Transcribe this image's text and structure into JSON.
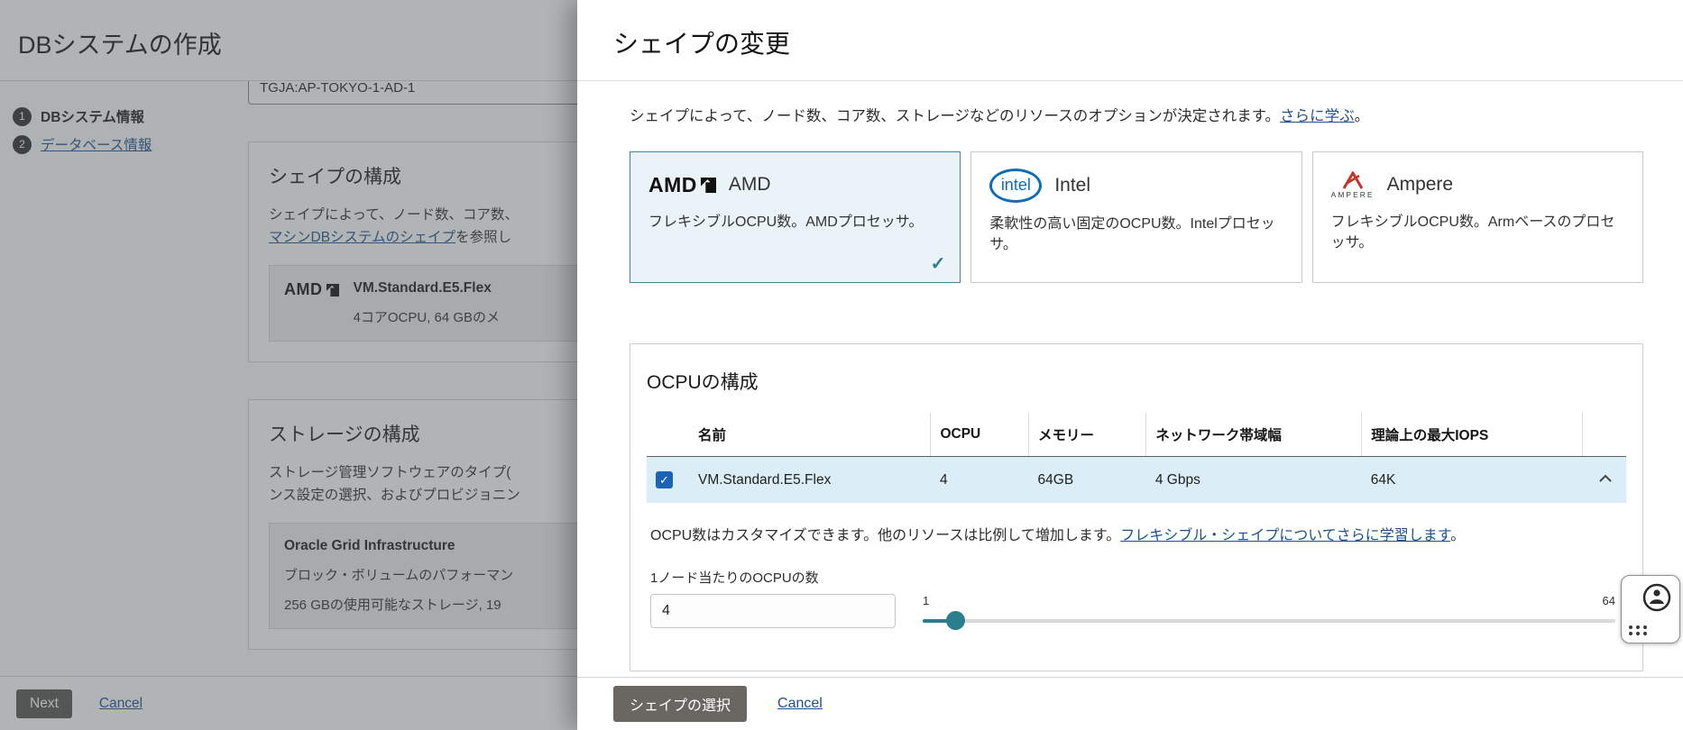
{
  "left": {
    "title": "DBシステムの作成",
    "steps": [
      {
        "number": "1",
        "label": "DBシステム情報"
      },
      {
        "number": "2",
        "label": "データベース情報"
      }
    ],
    "ad_value": "TGJA:AP-TOKYO-1-AD-1",
    "shape_section": {
      "title": "シェイプの構成",
      "desc_line1": "シェイプによって、ノード数、コア数、",
      "desc_link": "マシンDBシステムのシェイプ",
      "desc_line2_suffix": "を参照し",
      "card": {
        "brand_logo": "AMD",
        "name": "VM.Standard.E5.Flex",
        "detail": "4コアOCPU, 64 GBのメ"
      }
    },
    "storage_section": {
      "title": "ストレージの構成",
      "desc_line1": "ストレージ管理ソフトウェアのタイプ(",
      "desc_line2": "ンス設定の選択、およびプロビジョニン",
      "card": {
        "name": "Oracle Grid Infrastructure",
        "detail_line1": "ブロック・ボリュームのパフォーマン",
        "detail_line2": "256 GBの使用可能なストレージ, 19"
      }
    },
    "footer": {
      "next": "Next",
      "cancel": "Cancel"
    }
  },
  "panel": {
    "title": "シェイプの変更",
    "intro": {
      "text": "シェイプによって、ノード数、コア数、ストレージなどのリソースのオプションが決定されます。",
      "link": "さらに学ぶ",
      "period": "。"
    },
    "families": [
      {
        "logo": "AMD",
        "name": "AMD",
        "desc": "フレキシブルOCPU数。AMDプロセッサ。",
        "selected": true
      },
      {
        "logo": "intel",
        "name": "Intel",
        "desc": "柔軟性の高い固定のOCPU数。Intelプロセッサ。",
        "selected": false
      },
      {
        "logo": "AMPERE",
        "name": "Ampere",
        "desc": "フレキシブルOCPU数。Armベースのプロセッサ。",
        "selected": false
      }
    ],
    "ocpu": {
      "title": "OCPUの構成",
      "headers": [
        "名前",
        "OCPU",
        "メモリー",
        "ネットワーク帯域幅",
        "理論上の最大IOPS"
      ],
      "row": {
        "name": "VM.Standard.E5.Flex",
        "ocpu": "4",
        "memory": "64GB",
        "bandwidth": "4 Gbps",
        "iops": "64K"
      },
      "note": {
        "text": "OCPU数はカスタマイズできます。他のリソースは比例して増加します。",
        "link": "フレキシブル・シェイプについてさらに学習します",
        "period": "。"
      },
      "label": "1ノード当たりのOCPUの数",
      "value": "4",
      "slider": {
        "min": "1",
        "max": "64"
      }
    },
    "footer": {
      "select": "シェイプの選択",
      "cancel": "Cancel"
    }
  },
  "icons": {
    "check": "✓"
  },
  "colors": {
    "accent": "#2a7f8f",
    "link": "#1d4f91",
    "checkbox": "#1b63b7",
    "selected_bg": "#e9f3f8",
    "intel": "#0a6ebd",
    "ampere": "#c8322b",
    "btn": "#6a6662"
  }
}
